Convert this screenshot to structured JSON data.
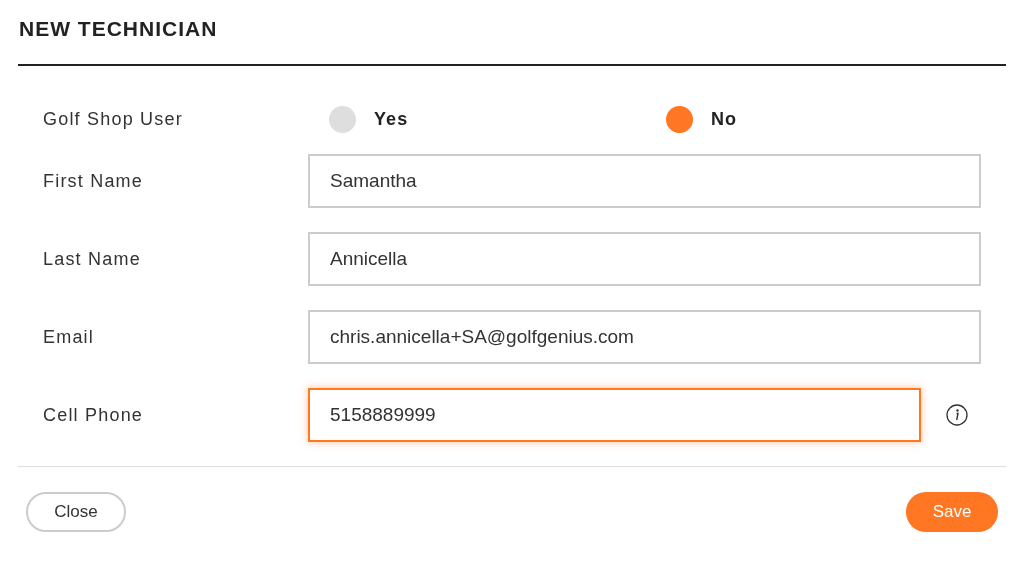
{
  "dialog": {
    "title": "NEW TECHNICIAN"
  },
  "golf_shop_user": {
    "label": "Golf Shop User",
    "options": [
      {
        "label": "Yes",
        "selected": false
      },
      {
        "label": "No",
        "selected": true
      }
    ]
  },
  "fields": [
    {
      "label": "First Name",
      "value": "Samantha",
      "focused": false,
      "info": false
    },
    {
      "label": "Last Name",
      "value": "Annicella",
      "focused": false,
      "info": false
    },
    {
      "label": "Email",
      "value": "chris.annicella+SA@golfgenius.com",
      "focused": false,
      "info": false
    },
    {
      "label": "Cell Phone",
      "value": "5158889999",
      "focused": true,
      "info": true
    }
  ],
  "buttons": {
    "close": "Close",
    "save": "Save"
  }
}
